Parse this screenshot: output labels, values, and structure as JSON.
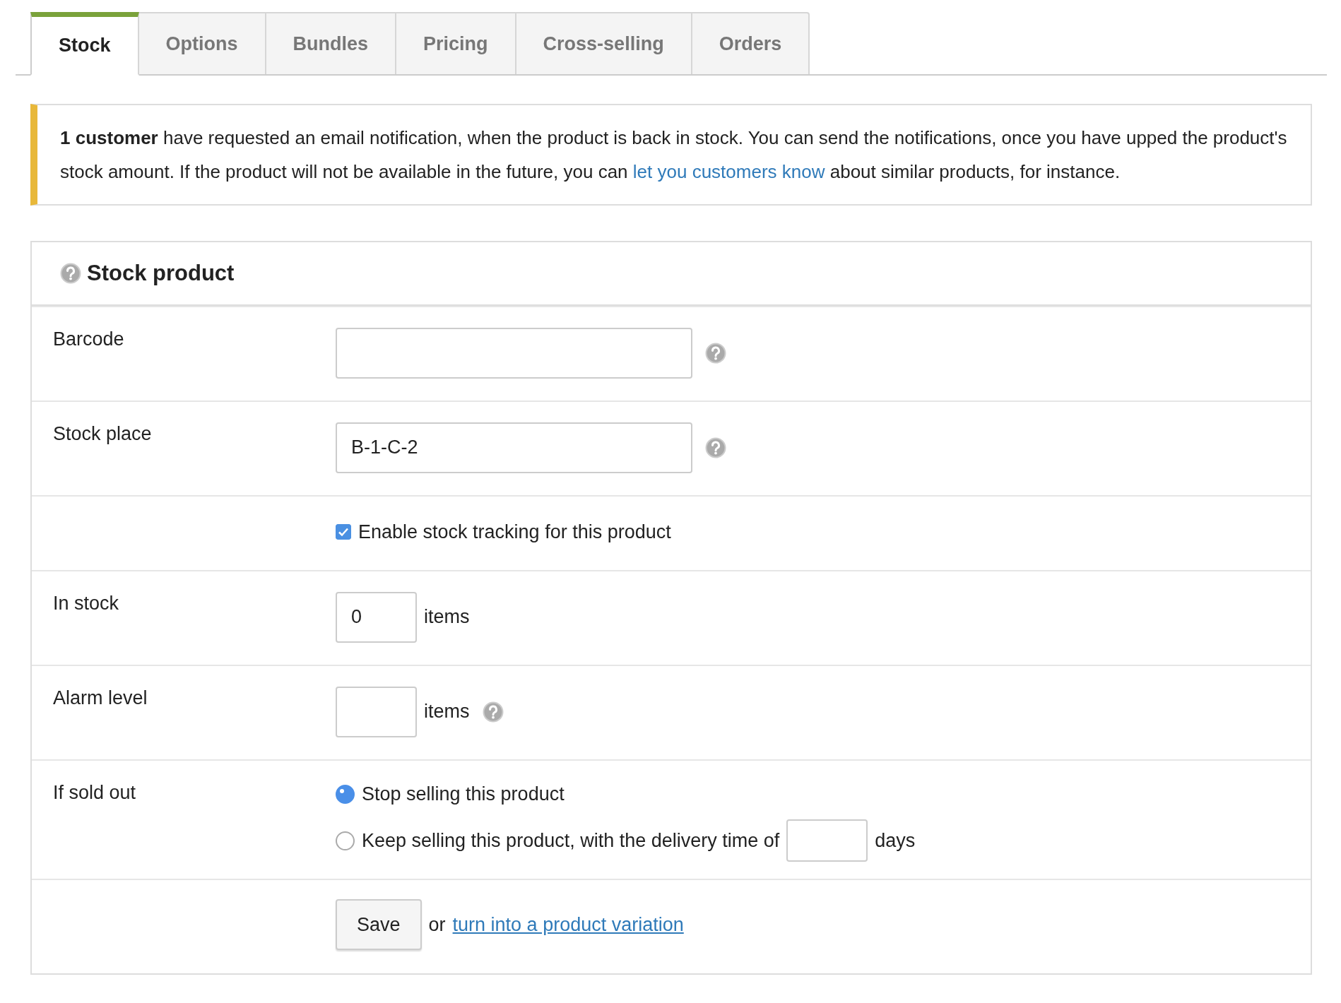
{
  "tabs": [
    {
      "label": "Stock",
      "selected": true
    },
    {
      "label": "Options",
      "selected": false
    },
    {
      "label": "Bundles",
      "selected": false
    },
    {
      "label": "Pricing",
      "selected": false
    },
    {
      "label": "Cross-selling",
      "selected": false
    },
    {
      "label": "Orders",
      "selected": false
    }
  ],
  "notice": {
    "text_before": "**1 customer** have requested an email notification, when the product is back in stock. You can send the notifications, once you have upped the product's stock amount. If the product will not be available in the future, you can",
    "link": "let you customers know",
    "text_after": "about similar products, for instance."
  },
  "panel": {
    "title": "Stock product",
    "help": true,
    "rows": [
      {
        "kind": "text",
        "label": "Barcode",
        "help": true
      },
      {
        "kind": "text",
        "label": "Stock place",
        "value": "B-1-C-2",
        "help": true
      },
      {
        "kind": "checkbox",
        "text": "Enable stock tracking for this product",
        "checked": true
      },
      {
        "kind": "number",
        "label": "In stock",
        "value": "0",
        "unit": "items",
        "help": false
      },
      {
        "kind": "number",
        "label": "Alarm level",
        "unit": "items",
        "help": true
      },
      {
        "kind": "radio",
        "label": "If sold out",
        "options": [
          {
            "text": "Stop selling this product",
            "selected": true
          },
          {
            "text": "Keep selling this product, with the delivery time of",
            "field": true,
            "unit": "days",
            "selected": false
          }
        ]
      },
      {
        "kind": "actions",
        "button": "Save",
        "or_text": "or",
        "link": "turn into a product variation"
      }
    ]
  }
}
